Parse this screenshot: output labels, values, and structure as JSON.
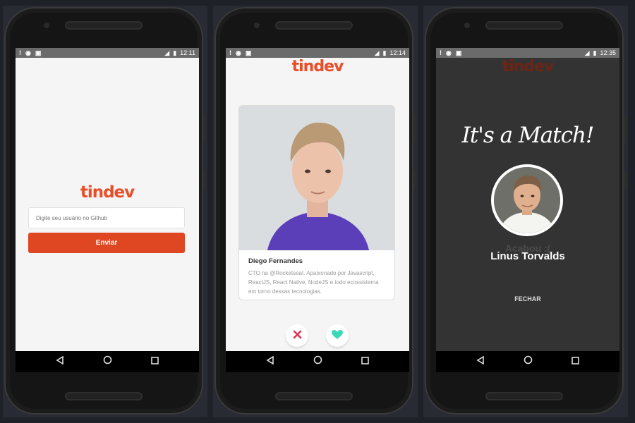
{
  "screens": [
    {
      "status": {
        "time": "12:11"
      },
      "logo": "tindev",
      "input_placeholder": "Digite seu usuário no Github",
      "button_label": "Enviar"
    },
    {
      "status": {
        "time": "12:14"
      },
      "logo": "tindev",
      "card": {
        "name": "Diego Fernandes",
        "bio": "CTO na @Rocketseat. Apaixonado por Javascript, ReactJS, React Native, NodeJS e todo ecossistema em torno dessas tecnologias."
      },
      "dislike_icon": "close-icon",
      "like_icon": "heart-icon"
    },
    {
      "status": {
        "time": "12:35"
      },
      "logo": "tindev",
      "match_title": "It's a Match!",
      "hidden_text": "Acabou :(",
      "match_name": "Linus Torvalds",
      "close_label": "FECHAR"
    }
  ],
  "colors": {
    "brand": "#e94e29",
    "button": "#df4723",
    "dislike": "#e0334f",
    "like": "#3cd9b7",
    "match_bg": "#333333"
  }
}
